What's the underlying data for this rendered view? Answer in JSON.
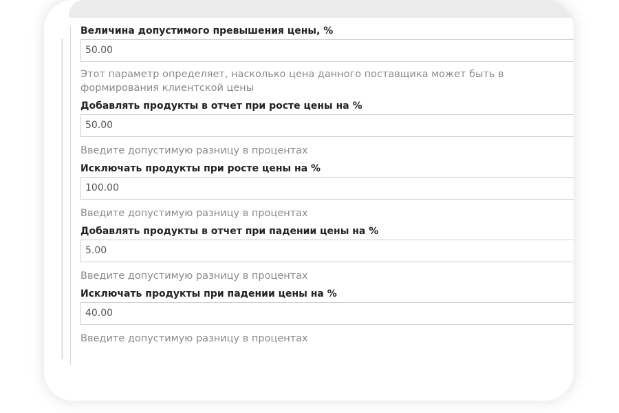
{
  "form": {
    "fields": [
      {
        "label": "Величина допустимого превышения цены, %",
        "value": "50.00",
        "help_line1": "Этот параметр определяет, насколько цена данного поставщика может быть в",
        "help_line2": "формирования клиентской цены"
      },
      {
        "label": "Добавлять продукты в отчет при росте цены на %",
        "value": "50.00",
        "help": "Введите допустимую разницу в процентах"
      },
      {
        "label": "Исключать продукты при росте цены на %",
        "value": "100.00",
        "help": "Введите допустимую разницу в процентах"
      },
      {
        "label": "Добавлять продукты в отчет при падении цены на %",
        "value": "5.00",
        "help": "Введите допустимую разницу в процентах"
      },
      {
        "label": "Исключать продукты при падении цены на %",
        "value": "40.00",
        "help": "Введите допустимую разницу в процентах"
      }
    ]
  },
  "colors": {
    "label_text": "#222222",
    "help_text": "#8a8a8a",
    "input_border": "#d0d0d0",
    "input_text": "#555555"
  }
}
